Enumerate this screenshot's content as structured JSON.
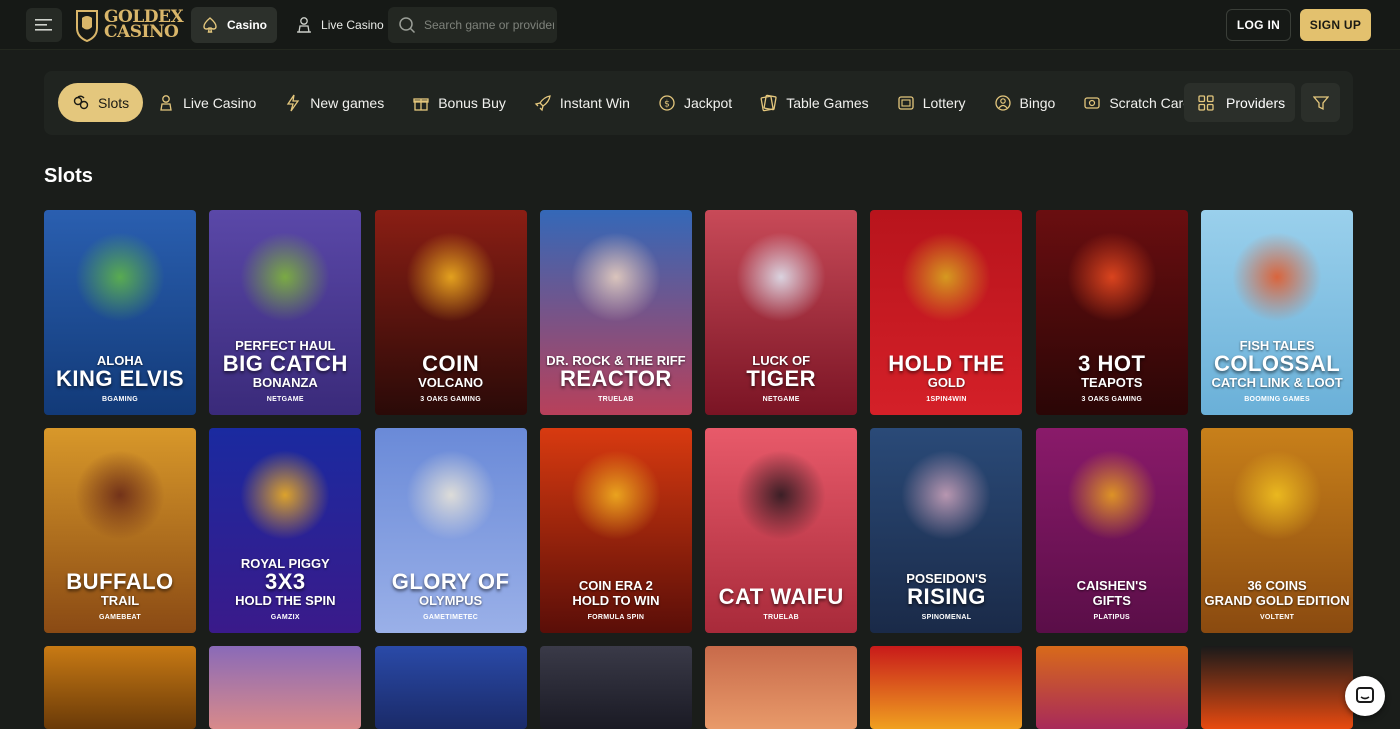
{
  "header": {
    "logo_top": "GOLDEX",
    "logo_bottom": "CASINO",
    "nav": [
      {
        "label": "Casino",
        "icon": "spade-icon",
        "active": true
      },
      {
        "label": "Live Casino",
        "icon": "dealer-icon",
        "active": false
      }
    ],
    "search": {
      "placeholder": "Search game or provider"
    },
    "login_label": "LOG IN",
    "signup_label": "SIGN UP"
  },
  "categories": [
    {
      "label": "Slots",
      "icon": "slots-icon",
      "active": true
    },
    {
      "label": "Live Casino",
      "icon": "dealer-icon"
    },
    {
      "label": "New games",
      "icon": "lightning-icon"
    },
    {
      "label": "Bonus Buy",
      "icon": "gift-icon"
    },
    {
      "label": "Instant Win",
      "icon": "rocket-icon"
    },
    {
      "label": "Jackpot",
      "icon": "coin-icon"
    },
    {
      "label": "Table Games",
      "icon": "cards-icon"
    },
    {
      "label": "Lottery",
      "icon": "ticket-icon"
    },
    {
      "label": "Bingo",
      "icon": "bingo-icon"
    },
    {
      "label": "Scratch Cards",
      "icon": "scratch-icon"
    }
  ],
  "providers_label": "Providers",
  "section_title": "Slots",
  "games": [
    {
      "l1": "ALOHA",
      "l2": "KING ELVIS",
      "l3": "",
      "provider": "BGAMING",
      "bg": "#2a5fb0",
      "bg2": "#123a78",
      "art": "#5fb548"
    },
    {
      "l1": "PERFECT HAUL",
      "l2": "BIG CATCH",
      "l3": "BONANZA",
      "provider": "NETGAME",
      "bg": "#5a48a8",
      "bg2": "#3a2a7a",
      "art": "#7fb63a"
    },
    {
      "l1": "",
      "l2": "COIN",
      "l3": "VOLCANO",
      "provider": "3 OAKS GAMING",
      "bg": "#8a1e14",
      "bg2": "#2a0a08",
      "art": "#f0b020"
    },
    {
      "l1": "DR. ROCK & THE RIFF",
      "l2": "REACTOR",
      "l3": "",
      "provider": "TRUELAB",
      "bg": "#3468b8",
      "bg2": "#b8405a",
      "art": "#e8d0c0"
    },
    {
      "l1": "LUCK OF",
      "l2": "TIGER",
      "l3": "",
      "provider": "NETGAME",
      "bg": "#c84a58",
      "bg2": "#7a1424",
      "art": "#dfe4f0"
    },
    {
      "l1": "",
      "l2": "HOLD THE",
      "l3": "GOLD",
      "provider": "1SPIN4WIN",
      "bg": "#b8141c",
      "bg2": "#d42028",
      "art": "#d8a820"
    },
    {
      "l1": "",
      "l2": "3 HOT",
      "l3": "TEAPOTS",
      "provider": "3 OAKS GAMING",
      "bg": "#6a0e10",
      "bg2": "#2a0606",
      "art": "#e84a20"
    },
    {
      "l1": "FISH TALES",
      "l2": "COLOSSAL",
      "l3": "CATCH LINK & LOOT",
      "provider": "BOOMING GAMES",
      "bg": "#9ad0ec",
      "bg2": "#6ab0d8",
      "art": "#e25a2a"
    },
    {
      "l1": "",
      "l2": "BUFFALO",
      "l3": "TRAIL",
      "provider": "GAMEBEAT",
      "bg": "#d8982a",
      "bg2": "#8a4a14",
      "art": "#6a2a18"
    },
    {
      "l1": "ROYAL PIGGY",
      "l2": "3X3",
      "l3": "HOLD THE SPIN",
      "provider": "GAMZIX",
      "bg": "#1a2aa0",
      "bg2": "#3a1a8a",
      "art": "#f0b020"
    },
    {
      "l1": "",
      "l2": "GLORY OF",
      "l3": "OLYMPUS",
      "provider": "GAMETIMETEC",
      "bg": "#6a8ad8",
      "bg2": "#9ab0e8",
      "art": "#e8e4d8"
    },
    {
      "l1": "COIN ERA 2",
      "l2": "",
      "l3": "HOLD TO WIN",
      "provider": "FORMULA SPIN",
      "bg": "#d83a10",
      "bg2": "#5a0e08",
      "art": "#f0b020"
    },
    {
      "l1": "",
      "l2": "CAT WAIFU",
      "l3": "",
      "provider": "TRUELAB",
      "bg": "#e85a6a",
      "bg2": "#a82a3a",
      "art": "#2a1a20"
    },
    {
      "l1": "POSEIDON'S",
      "l2": "RISING",
      "l3": "",
      "provider": "SPINOMENAL",
      "bg": "#2a4a78",
      "bg2": "#1a2a48",
      "art": "#c8a0b8"
    },
    {
      "l1": "CAISHEN'S",
      "l2": "",
      "l3": "GIFTS",
      "provider": "PLATIPUS",
      "bg": "#8a1a6a",
      "bg2": "#5a0e48",
      "art": "#e8a020"
    },
    {
      "l1": "36 COINS",
      "l2": "",
      "l3": "GRAND GOLD EDITION",
      "provider": "VOLTENT",
      "bg": "#c8801a",
      "bg2": "#8a4a10",
      "art": "#f0c020"
    }
  ],
  "row3": [
    {
      "bg": "#c87a14",
      "bg2": "#6a3a08"
    },
    {
      "bg": "#8a6ab8",
      "bg2": "#d88a8a"
    },
    {
      "bg": "#2a4aa8",
      "bg2": "#1a2a68"
    },
    {
      "bg": "#3a3a48",
      "bg2": "#1a1a24"
    },
    {
      "bg": "#c86a4a",
      "bg2": "#e89a6a"
    },
    {
      "bg": "#c81a1a",
      "bg2": "#f0a020"
    },
    {
      "bg": "#d86a1a",
      "bg2": "#a82a5a"
    },
    {
      "bg": "#1a1a1a",
      "bg2": "#e84a10"
    }
  ],
  "colors": {
    "accent": "#e4c77d",
    "bg": "#1a1d1a",
    "panel": "#202420"
  }
}
